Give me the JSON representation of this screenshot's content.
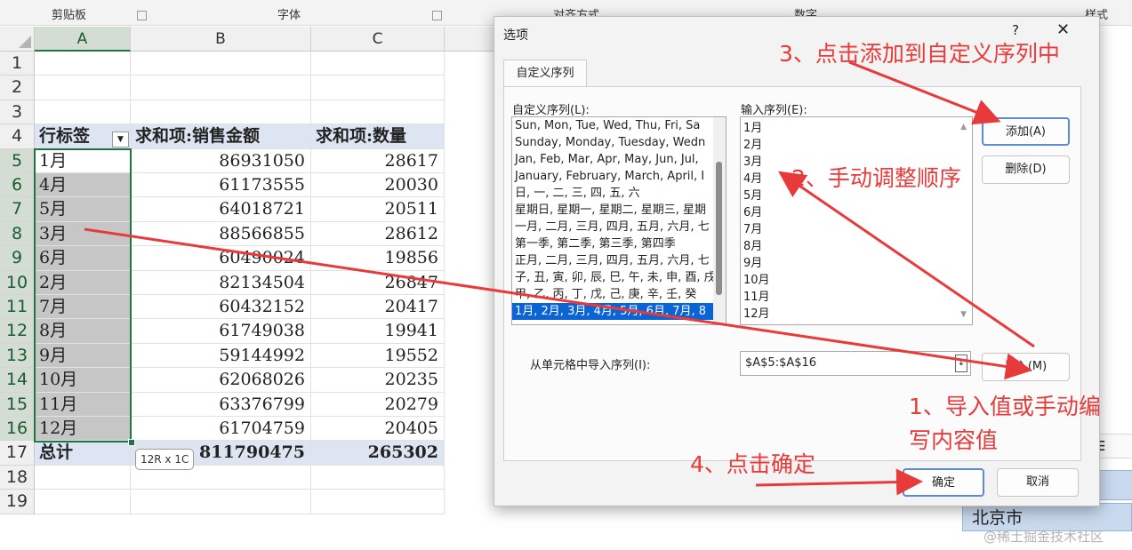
{
  "ribbon": {
    "groups": [
      "剪贴板",
      "字体",
      "对齐方式",
      "数字",
      "样式"
    ]
  },
  "columns": [
    "A",
    "B",
    "C"
  ],
  "rows": [
    "1",
    "2",
    "3",
    "4",
    "5",
    "6",
    "7",
    "8",
    "9",
    "10",
    "11",
    "12",
    "13",
    "14",
    "15",
    "16",
    "17",
    "18",
    "19"
  ],
  "pivot": {
    "header": {
      "label": "行标签",
      "sum_sales": "求和项:销售金额",
      "sum_qty": "求和项:数量"
    },
    "data": [
      {
        "label": "1月",
        "sales": "86931050",
        "qty": "28617"
      },
      {
        "label": "4月",
        "sales": "61173555",
        "qty": "20030"
      },
      {
        "label": "5月",
        "sales": "64018721",
        "qty": "20511"
      },
      {
        "label": "3月",
        "sales": "88566855",
        "qty": "28612"
      },
      {
        "label": "6月",
        "sales": "60490024",
        "qty": "19856"
      },
      {
        "label": "2月",
        "sales": "82134504",
        "qty": "26847"
      },
      {
        "label": "7月",
        "sales": "60432152",
        "qty": "20417"
      },
      {
        "label": "8月",
        "sales": "61749038",
        "qty": "19941"
      },
      {
        "label": "9月",
        "sales": "59144992",
        "qty": "19552"
      },
      {
        "label": "10月",
        "sales": "62068026",
        "qty": "20235"
      },
      {
        "label": "11月",
        "sales": "63376799",
        "qty": "20279"
      },
      {
        "label": "12月",
        "sales": "61704759",
        "qty": "20405"
      }
    ],
    "total": {
      "label": "总计",
      "sales": "811790475",
      "qty": "265302"
    },
    "selection_tooltip": "12R x 1C"
  },
  "dialog": {
    "title": "选项",
    "help": "?",
    "close": "✕",
    "tab": "自定义序列",
    "custom_lists_label": "自定义序列(L):",
    "custom_lists": [
      "Sun, Mon, Tue, Wed, Thu, Fri, Sa",
      "Sunday, Monday, Tuesday, Wedn",
      "Jan, Feb, Mar, Apr, May, Jun, Jul,",
      "January, February, March, April, I",
      "日, 一, 二, 三, 四, 五, 六",
      "星期日, 星期一, 星期二, 星期三, 星期",
      "一月, 二月, 三月, 四月, 五月, 六月, 七",
      "第一季, 第二季, 第三季, 第四季",
      "正月, 二月, 三月, 四月, 五月, 六月, 七",
      "子, 丑, 寅, 卯, 辰, 巳, 午, 未, 申, 酉, 戌",
      "甲, 乙, 丙, 丁, 戊, 己, 庚, 辛, 壬, 癸",
      "1月, 2月, 3月, 4月, 5月, 6月, 7月, 8"
    ],
    "entries_label": "输入序列(E):",
    "entries": [
      "1月",
      "2月",
      "3月",
      "4月",
      "5月",
      "6月",
      "7月",
      "8月",
      "9月",
      "10月",
      "11月",
      "12月"
    ],
    "add_button": "添加(A)",
    "delete_button": "删除(D)",
    "import_label": "从单元格中导入序列(I):",
    "import_value": "$A$5:$A$16",
    "import_button": "导入(M)",
    "ok_button": "确定",
    "cancel_button": "取消"
  },
  "background": {
    "slicer_item": "北京市"
  },
  "annotations": {
    "step1_line1": "1、导入值或手动编",
    "step1_line2": "写内容值",
    "step2": "2、手动调整顺序",
    "step3": "3、点击添加到自定义序列中",
    "step4": "4、点击确定"
  },
  "watermark": "@稀土掘金技术社区",
  "colors": {
    "annotation": "#e83a3a",
    "selection_accent": "#217346",
    "pivot_header_fill": "#dde5f2",
    "list_highlight": "#0a64d6"
  }
}
